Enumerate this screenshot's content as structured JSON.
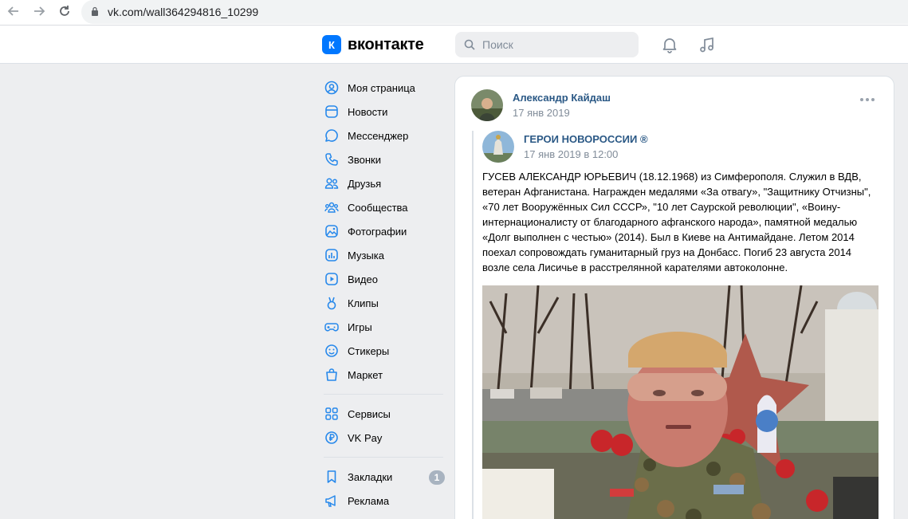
{
  "browser": {
    "url": "vk.com/wall364294816_10299"
  },
  "header": {
    "logo_text": "вконтакте",
    "logo_letter": "К",
    "search_placeholder": "Поиск"
  },
  "sidebar": {
    "items": [
      {
        "label": "Моя страница",
        "icon": "user-circle-icon"
      },
      {
        "label": "Новости",
        "icon": "news-icon"
      },
      {
        "label": "Мессенджер",
        "icon": "message-icon"
      },
      {
        "label": "Звонки",
        "icon": "phone-icon"
      },
      {
        "label": "Друзья",
        "icon": "friends-icon"
      },
      {
        "label": "Сообщества",
        "icon": "communities-icon"
      },
      {
        "label": "Фотографии",
        "icon": "photos-icon"
      },
      {
        "label": "Музыка",
        "icon": "music-icon"
      },
      {
        "label": "Видео",
        "icon": "video-icon"
      },
      {
        "label": "Клипы",
        "icon": "clips-icon"
      },
      {
        "label": "Игры",
        "icon": "games-icon"
      },
      {
        "label": "Стикеры",
        "icon": "stickers-icon"
      },
      {
        "label": "Маркет",
        "icon": "market-icon"
      }
    ],
    "secondary": [
      {
        "label": "Сервисы",
        "icon": "services-icon"
      },
      {
        "label": "VK Pay",
        "icon": "vkpay-icon"
      }
    ],
    "tertiary": [
      {
        "label": "Закладки",
        "icon": "bookmark-icon",
        "badge": "1"
      },
      {
        "label": "Реклама",
        "icon": "megaphone-icon"
      }
    ]
  },
  "post": {
    "author": "Александр Кайдаш",
    "date": "17 янв 2019",
    "repost": {
      "source": "ГЕРОИ НОВОРОССИИ ®",
      "date": "17 янв 2019 в 12:00",
      "text": "ГУСЕВ АЛЕКСАНДР ЮРЬЕВИЧ (18.12.1968) из Симферополя. Служил в ВДВ, ветеран Афганистана. Награжден медалями «За отвагу», \"Защитнику Отчизны\", «70 лет Вооружённых Сил СССР», \"10 лет Саурской революции\", «Воину-интернационалисту от благодарного афганского народа», памятной медалью «Долг выполнен с честью» (2014). Был в Киеве на Антимайдане. Летом 2014 поехал сопровождать гуманитарный груз на Донбасс. Погиб 23 августа 2014 возле села Лисичье в расстрелянной карателями автоколонне."
    }
  },
  "colors": {
    "accent": "#0077ff",
    "link": "#2a5885",
    "icon": "#2688eb",
    "muted": "#818c99",
    "background": "#edeef0"
  }
}
